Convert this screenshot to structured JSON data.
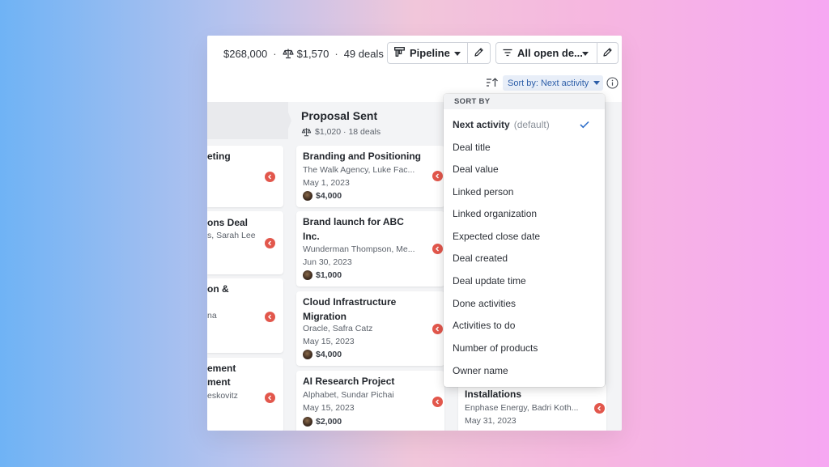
{
  "summary": {
    "total_value": "$268,000",
    "weighted_value": "$1,570",
    "deal_count": "49 deals",
    "separator": "·"
  },
  "toolbar": {
    "pipeline_label": "Pipeline",
    "filter_label": "All open de..."
  },
  "sort": {
    "button_label": "Sort by: Next activity"
  },
  "left_column": {
    "cards": [
      {
        "title": "eting",
        "subtitle": ""
      },
      {
        "title": "ons Deal",
        "subtitle": "s, Sarah Lee"
      },
      {
        "title": "on &",
        "subtitle": "na"
      },
      {
        "title": "ement",
        "title2": "ment",
        "subtitle": "eskovitz"
      }
    ]
  },
  "middle_column": {
    "title": "Proposal Sent",
    "meta": "$1,020 · 18 deals",
    "cards": [
      {
        "title": "Branding and Positioning",
        "org": "The Walk Agency, Luke Fac...",
        "date": "May 1, 2023",
        "value": "$4,000"
      },
      {
        "title": "Brand launch for ABC Inc.",
        "org": "Wunderman Thompson, Me...",
        "date": "Jun 30, 2023",
        "value": "$1,000"
      },
      {
        "title": "Cloud Infrastructure Migration",
        "org": "Oracle, Safra Catz",
        "date": "May 15, 2023",
        "value": "$4,000"
      },
      {
        "title": "AI Research Project",
        "org": "Alphabet, Sundar Pichai",
        "date": "May 15, 2023",
        "value": "$2,000"
      }
    ]
  },
  "right_column": {
    "cards": [
      {
        "title": "Installations",
        "org": "Enphase Energy, Badri Koth...",
        "date": "May 31, 2023"
      }
    ]
  },
  "sort_menu": {
    "header": "SORT BY",
    "default_suffix": "(default)",
    "items": [
      {
        "label": "Next activity",
        "selected": true
      },
      {
        "label": "Deal title"
      },
      {
        "label": "Deal value"
      },
      {
        "label": "Linked person"
      },
      {
        "label": "Linked organization"
      },
      {
        "label": "Expected close date"
      },
      {
        "label": "Deal created"
      },
      {
        "label": "Deal update time"
      },
      {
        "label": "Done activities"
      },
      {
        "label": "Activities to do"
      },
      {
        "label": "Number of products"
      },
      {
        "label": "Owner name"
      }
    ]
  },
  "colors": {
    "accent": "#2d5ea8",
    "overdue": "#e2574c",
    "check": "#2f6fca"
  },
  "icons": [
    "scale-icon",
    "pipeline-icon",
    "pencil-icon",
    "filter-icon",
    "sort-order-icon",
    "info-icon",
    "overdue-icon",
    "check-icon",
    "avatar"
  ]
}
